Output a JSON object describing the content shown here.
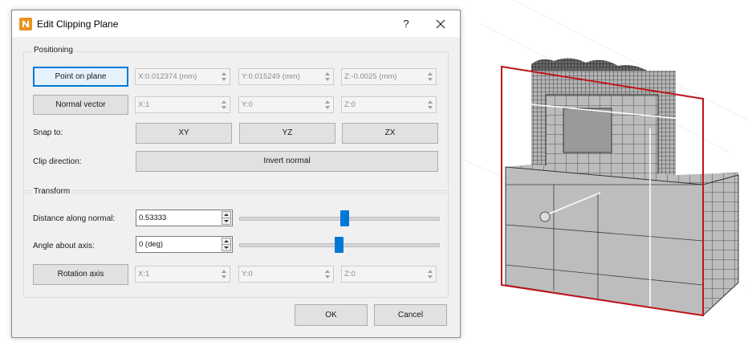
{
  "dialog": {
    "title": "Edit Clipping Plane",
    "help_glyph": "?"
  },
  "positioning": {
    "label": "Positioning",
    "point_on_plane_button": "Point on plane",
    "point_fields": [
      "X:0.012374 (mm)",
      "Y:0.015249 (mm)",
      "Z:-0.0025 (mm)"
    ],
    "normal_vector_button": "Normal vector",
    "normal_fields": [
      "X:1",
      "Y:0",
      "Z:0"
    ],
    "snap_label": "Snap to:",
    "snap_buttons": [
      "XY",
      "YZ",
      "ZX"
    ],
    "clip_direction_label": "Clip direction:",
    "invert_normal_button": "Invert normal"
  },
  "transform": {
    "label": "Transform",
    "distance_label": "Distance along normal:",
    "distance_value": "0.53333",
    "distance_slider_fraction": 0.53,
    "angle_label": "Angle about axis:",
    "angle_value": "0 (deg)",
    "angle_slider_fraction": 0.5,
    "rotation_axis_button": "Rotation axis",
    "rotation_fields": [
      "X:1",
      "Y:0",
      "Z:0"
    ]
  },
  "footer": {
    "ok_button": "OK",
    "cancel_button": "Cancel"
  },
  "colors": {
    "accent": "#0078d7",
    "app_icon": "#e8941f",
    "clip_plane": "#c0141a"
  }
}
